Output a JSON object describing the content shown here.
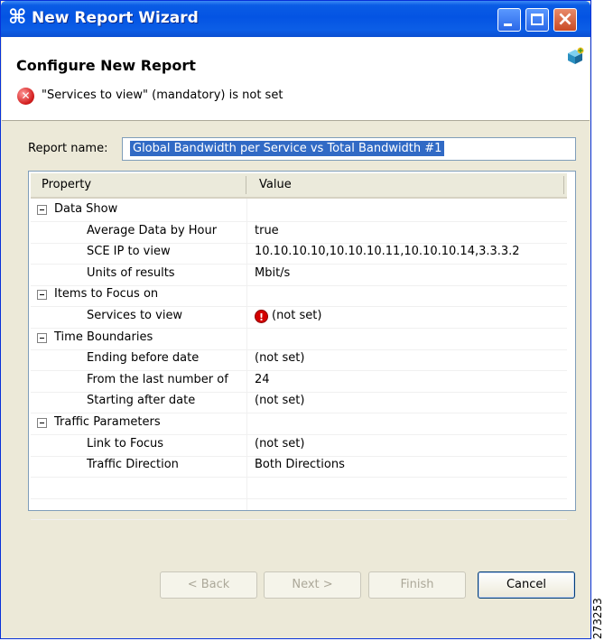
{
  "window": {
    "title": "New Report Wizard",
    "app_icon": "⌘"
  },
  "header": {
    "title": "Configure New Report",
    "error_message": "\"Services to view\" (mandatory) is not set"
  },
  "report_name": {
    "label": "Report name:",
    "value": "Global Bandwidth per Service vs Total Bandwidth #1"
  },
  "table": {
    "columns": [
      "Property",
      "Value"
    ],
    "rows": [
      {
        "type": "group",
        "label": "Data Show"
      },
      {
        "type": "prop",
        "label": "Average Data by Hour",
        "value": "true"
      },
      {
        "type": "prop",
        "label": "SCE IP to view",
        "value": "10.10.10.10,10.10.10.11,10.10.10.14,3.3.3.2"
      },
      {
        "type": "prop",
        "label": "Units of results",
        "value": "Mbit/s"
      },
      {
        "type": "group",
        "label": "Items to Focus on"
      },
      {
        "type": "prop",
        "label": "Services to view",
        "value": "(not set)",
        "error": true
      },
      {
        "type": "group",
        "label": "Time Boundaries"
      },
      {
        "type": "prop",
        "label": "Ending before date",
        "value": "(not set)"
      },
      {
        "type": "prop",
        "label": "From the last number of",
        "value": "24"
      },
      {
        "type": "prop",
        "label": "Starting after date",
        "value": "(not set)"
      },
      {
        "type": "group",
        "label": "Traffic Parameters"
      },
      {
        "type": "prop",
        "label": "Link to Focus",
        "value": "(not set)"
      },
      {
        "type": "prop",
        "label": "Traffic Direction",
        "value": "Both Directions"
      }
    ]
  },
  "buttons": {
    "back": "< Back",
    "next": "Next >",
    "finish": "Finish",
    "cancel": "Cancel"
  },
  "side_code": "273253",
  "colors": {
    "titlebar": "#0454e3",
    "selection": "#316ac5",
    "error": "#d42020"
  }
}
